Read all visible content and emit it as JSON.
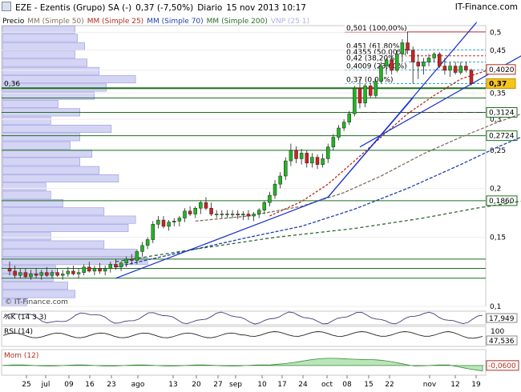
{
  "header": {
    "symbol": "EZE - Ezentis (Grupo) SA (-)",
    "last": "0,37 (-7,50%)",
    "period": "Diario",
    "datetime": "15 nov 2013 10:17",
    "brand": "IT-Finance.com"
  },
  "legend": {
    "price": "Precio",
    "ma50": "MM (Simple 50)",
    "ma25": "MM (Simple 25)",
    "ma70": "MM (Simple 70)",
    "ma200": "MM (Simple 200)",
    "vnp": "VNP (25 1)"
  },
  "watermark": "© IT-Finance.com",
  "colors": {
    "up": "#22b522",
    "down": "#d02020",
    "ma25": "#b03020",
    "ma50": "#807060",
    "ma70": "#2040b0",
    "ma200": "#2a6a2a",
    "trend": "#1a30d0",
    "support": "#1e6e1e",
    "vnp": "#9898e0",
    "fib": "#3aa0c8"
  },
  "chart_data": [
    {
      "type": "candlestick",
      "name": "main",
      "yscale": "log",
      "ylim": [
        0.1,
        0.52
      ],
      "y_ticks": [
        "0,5",
        "0,45",
        "0,4",
        "0,35",
        "0,3",
        "0,25",
        "0,2",
        "0,15",
        "0,1"
      ],
      "y_tick_values": [
        0.5,
        0.45,
        0.4,
        0.35,
        0.3,
        0.25,
        0.2,
        0.15,
        0.1
      ],
      "x_ticks": [
        "25",
        "jul",
        "09",
        "16",
        "23",
        "ago",
        "13",
        "20",
        "27",
        "sep",
        "10",
        "17",
        "24",
        "oct",
        "08",
        "15",
        "22",
        "nov",
        "12",
        "19"
      ],
      "candles": [
        {
          "o": 0.125,
          "h": 0.13,
          "l": 0.12,
          "c": 0.123
        },
        {
          "o": 0.123,
          "h": 0.127,
          "l": 0.118,
          "c": 0.12
        },
        {
          "o": 0.12,
          "h": 0.125,
          "l": 0.118,
          "c": 0.122
        },
        {
          "o": 0.122,
          "h": 0.125,
          "l": 0.118,
          "c": 0.119
        },
        {
          "o": 0.119,
          "h": 0.124,
          "l": 0.117,
          "c": 0.121
        },
        {
          "o": 0.121,
          "h": 0.125,
          "l": 0.118,
          "c": 0.12
        },
        {
          "o": 0.12,
          "h": 0.124,
          "l": 0.117,
          "c": 0.122
        },
        {
          "o": 0.122,
          "h": 0.126,
          "l": 0.119,
          "c": 0.12
        },
        {
          "o": 0.12,
          "h": 0.124,
          "l": 0.118,
          "c": 0.122
        },
        {
          "o": 0.122,
          "h": 0.125,
          "l": 0.119,
          "c": 0.12
        },
        {
          "o": 0.12,
          "h": 0.124,
          "l": 0.117,
          "c": 0.121
        },
        {
          "o": 0.121,
          "h": 0.126,
          "l": 0.119,
          "c": 0.123
        },
        {
          "o": 0.123,
          "h": 0.127,
          "l": 0.12,
          "c": 0.121
        },
        {
          "o": 0.121,
          "h": 0.125,
          "l": 0.118,
          "c": 0.122
        },
        {
          "o": 0.122,
          "h": 0.128,
          "l": 0.12,
          "c": 0.126
        },
        {
          "o": 0.126,
          "h": 0.13,
          "l": 0.122,
          "c": 0.123
        },
        {
          "o": 0.123,
          "h": 0.127,
          "l": 0.12,
          "c": 0.125
        },
        {
          "o": 0.125,
          "h": 0.129,
          "l": 0.121,
          "c": 0.123
        },
        {
          "o": 0.123,
          "h": 0.127,
          "l": 0.12,
          "c": 0.125
        },
        {
          "o": 0.125,
          "h": 0.13,
          "l": 0.122,
          "c": 0.128
        },
        {
          "o": 0.128,
          "h": 0.132,
          "l": 0.124,
          "c": 0.126
        },
        {
          "o": 0.126,
          "h": 0.13,
          "l": 0.123,
          "c": 0.129
        },
        {
          "o": 0.129,
          "h": 0.134,
          "l": 0.126,
          "c": 0.132
        },
        {
          "o": 0.132,
          "h": 0.136,
          "l": 0.128,
          "c": 0.131
        },
        {
          "o": 0.131,
          "h": 0.14,
          "l": 0.128,
          "c": 0.138
        },
        {
          "o": 0.138,
          "h": 0.146,
          "l": 0.134,
          "c": 0.143
        },
        {
          "o": 0.143,
          "h": 0.15,
          "l": 0.14,
          "c": 0.148
        },
        {
          "o": 0.148,
          "h": 0.165,
          "l": 0.145,
          "c": 0.162
        },
        {
          "o": 0.162,
          "h": 0.17,
          "l": 0.158,
          "c": 0.166
        },
        {
          "o": 0.166,
          "h": 0.17,
          "l": 0.158,
          "c": 0.16
        },
        {
          "o": 0.16,
          "h": 0.166,
          "l": 0.156,
          "c": 0.164
        },
        {
          "o": 0.164,
          "h": 0.168,
          "l": 0.16,
          "c": 0.165
        },
        {
          "o": 0.165,
          "h": 0.17,
          "l": 0.16,
          "c": 0.168
        },
        {
          "o": 0.168,
          "h": 0.178,
          "l": 0.164,
          "c": 0.175
        },
        {
          "o": 0.175,
          "h": 0.18,
          "l": 0.17,
          "c": 0.172
        },
        {
          "o": 0.172,
          "h": 0.18,
          "l": 0.168,
          "c": 0.178
        },
        {
          "o": 0.178,
          "h": 0.186,
          "l": 0.172,
          "c": 0.184
        },
        {
          "o": 0.184,
          "h": 0.19,
          "l": 0.176,
          "c": 0.178
        },
        {
          "o": 0.178,
          "h": 0.184,
          "l": 0.17,
          "c": 0.172
        },
        {
          "o": 0.172,
          "h": 0.176,
          "l": 0.168,
          "c": 0.172
        },
        {
          "o": 0.172,
          "h": 0.176,
          "l": 0.168,
          "c": 0.172
        },
        {
          "o": 0.172,
          "h": 0.176,
          "l": 0.168,
          "c": 0.172
        },
        {
          "o": 0.172,
          "h": 0.176,
          "l": 0.168,
          "c": 0.172
        },
        {
          "o": 0.172,
          "h": 0.176,
          "l": 0.167,
          "c": 0.171
        },
        {
          "o": 0.171,
          "h": 0.175,
          "l": 0.166,
          "c": 0.172
        },
        {
          "o": 0.172,
          "h": 0.176,
          "l": 0.166,
          "c": 0.17
        },
        {
          "o": 0.17,
          "h": 0.174,
          "l": 0.165,
          "c": 0.172
        },
        {
          "o": 0.172,
          "h": 0.178,
          "l": 0.168,
          "c": 0.176
        },
        {
          "o": 0.176,
          "h": 0.186,
          "l": 0.172,
          "c": 0.184
        },
        {
          "o": 0.184,
          "h": 0.196,
          "l": 0.18,
          "c": 0.192
        },
        {
          "o": 0.192,
          "h": 0.21,
          "l": 0.188,
          "c": 0.205
        },
        {
          "o": 0.205,
          "h": 0.22,
          "l": 0.2,
          "c": 0.215
        },
        {
          "o": 0.215,
          "h": 0.24,
          "l": 0.21,
          "c": 0.235
        },
        {
          "o": 0.235,
          "h": 0.26,
          "l": 0.228,
          "c": 0.25
        },
        {
          "o": 0.25,
          "h": 0.256,
          "l": 0.232,
          "c": 0.238
        },
        {
          "o": 0.238,
          "h": 0.252,
          "l": 0.23,
          "c": 0.246
        },
        {
          "o": 0.246,
          "h": 0.25,
          "l": 0.226,
          "c": 0.232
        },
        {
          "o": 0.232,
          "h": 0.246,
          "l": 0.226,
          "c": 0.24
        },
        {
          "o": 0.24,
          "h": 0.244,
          "l": 0.224,
          "c": 0.23
        },
        {
          "o": 0.23,
          "h": 0.245,
          "l": 0.226,
          "c": 0.238
        },
        {
          "o": 0.238,
          "h": 0.26,
          "l": 0.232,
          "c": 0.255
        },
        {
          "o": 0.255,
          "h": 0.275,
          "l": 0.25,
          "c": 0.27
        },
        {
          "o": 0.27,
          "h": 0.29,
          "l": 0.265,
          "c": 0.285
        },
        {
          "o": 0.285,
          "h": 0.3,
          "l": 0.28,
          "c": 0.295
        },
        {
          "o": 0.295,
          "h": 0.315,
          "l": 0.29,
          "c": 0.31
        },
        {
          "o": 0.31,
          "h": 0.365,
          "l": 0.305,
          "c": 0.36
        },
        {
          "o": 0.36,
          "h": 0.38,
          "l": 0.32,
          "c": 0.33
        },
        {
          "o": 0.33,
          "h": 0.37,
          "l": 0.322,
          "c": 0.365
        },
        {
          "o": 0.365,
          "h": 0.372,
          "l": 0.34,
          "c": 0.345
        },
        {
          "o": 0.345,
          "h": 0.38,
          "l": 0.34,
          "c": 0.375
        },
        {
          "o": 0.375,
          "h": 0.42,
          "l": 0.37,
          "c": 0.41
        },
        {
          "o": 0.41,
          "h": 0.43,
          "l": 0.39,
          "c": 0.425
        },
        {
          "o": 0.425,
          "h": 0.44,
          "l": 0.39,
          "c": 0.4
        },
        {
          "o": 0.4,
          "h": 0.45,
          "l": 0.395,
          "c": 0.44
        },
        {
          "o": 0.44,
          "h": 0.48,
          "l": 0.42,
          "c": 0.47
        },
        {
          "o": 0.47,
          "h": 0.501,
          "l": 0.44,
          "c": 0.45
        },
        {
          "o": 0.45,
          "h": 0.46,
          "l": 0.37,
          "c": 0.42
        },
        {
          "o": 0.42,
          "h": 0.44,
          "l": 0.38,
          "c": 0.41
        },
        {
          "o": 0.41,
          "h": 0.43,
          "l": 0.39,
          "c": 0.42
        },
        {
          "o": 0.42,
          "h": 0.44,
          "l": 0.41,
          "c": 0.43
        },
        {
          "o": 0.43,
          "h": 0.445,
          "l": 0.42,
          "c": 0.44
        },
        {
          "o": 0.44,
          "h": 0.445,
          "l": 0.405,
          "c": 0.41
        },
        {
          "o": 0.41,
          "h": 0.43,
          "l": 0.39,
          "c": 0.4
        },
        {
          "o": 0.4,
          "h": 0.42,
          "l": 0.385,
          "c": 0.41
        },
        {
          "o": 0.41,
          "h": 0.42,
          "l": 0.39,
          "c": 0.395
        },
        {
          "o": 0.395,
          "h": 0.42,
          "l": 0.39,
          "c": 0.41
        },
        {
          "o": 0.41,
          "h": 0.42,
          "l": 0.395,
          "c": 0.4
        },
        {
          "o": 0.4,
          "h": 0.404,
          "l": 0.366,
          "c": 0.37
        }
      ],
      "horizontal_levels": [
        {
          "label": "0,36",
          "value": 0.36,
          "side": "left"
        },
        {
          "label": "",
          "value": 0.34
        },
        {
          "label": "0,3124",
          "value": 0.3124,
          "side": "right"
        },
        {
          "label": "0,2724",
          "value": 0.2724,
          "side": "right"
        },
        {
          "label": "",
          "value": 0.25
        },
        {
          "label": "0,1860",
          "value": 0.186,
          "side": "right"
        },
        {
          "label": "",
          "value": 0.132
        },
        {
          "label": "",
          "value": 0.125
        },
        {
          "label": "",
          "value": 0.118
        }
      ],
      "fibonacci": [
        {
          "label": "0,501 (100,00%)",
          "value": 0.501
        },
        {
          "label": "0,451 (61,80%)",
          "value": 0.451
        },
        {
          "label": "0,4355 (50,00%)",
          "value": 0.4355
        },
        {
          "label": "0,42 (38,20%)",
          "value": 0.42
        },
        {
          "label": "0,4009 (23,60%)",
          "value": 0.4009
        },
        {
          "label": "0,37 (0,00%)",
          "value": 0.37
        }
      ],
      "price_labels": [
        {
          "label": "0,4020",
          "value": 0.402,
          "kind": "ma25"
        },
        {
          "label": "0,37",
          "value": 0.37,
          "kind": "last"
        }
      ],
      "moving_averages": {
        "ma25": [
          [
            49,
            0.17
          ],
          [
            55,
            0.185
          ],
          [
            60,
            0.205
          ],
          [
            65,
            0.235
          ],
          [
            70,
            0.27
          ],
          [
            75,
            0.31
          ],
          [
            80,
            0.345
          ],
          [
            85,
            0.38
          ],
          [
            90,
            0.4
          ],
          [
            95,
            0.402
          ]
        ],
        "ma50": [
          [
            35,
            0.165
          ],
          [
            45,
            0.17
          ],
          [
            55,
            0.18
          ],
          [
            63,
            0.195
          ],
          [
            70,
            0.215
          ],
          [
            78,
            0.245
          ],
          [
            85,
            0.27
          ],
          [
            92,
            0.295
          ],
          [
            97,
            0.312
          ]
        ],
        "ma70": [
          [
            20,
            0.126
          ],
          [
            35,
            0.14
          ],
          [
            45,
            0.15
          ],
          [
            55,
            0.16
          ],
          [
            65,
            0.177
          ],
          [
            75,
            0.2
          ],
          [
            85,
            0.23
          ],
          [
            92,
            0.255
          ],
          [
            97,
            0.2724
          ]
        ],
        "ma200": [
          [
            20,
            0.13
          ],
          [
            35,
            0.14
          ],
          [
            50,
            0.15
          ],
          [
            65,
            0.158
          ],
          [
            78,
            0.168
          ],
          [
            88,
            0.178
          ],
          [
            97,
            0.186
          ]
        ]
      },
      "vnp_bars": [
        0.3,
        0.31,
        0.34,
        0.3,
        0.35,
        0.4,
        0.55,
        0.43,
        0.38,
        0.23,
        0.32,
        0.2,
        0.45,
        0.32,
        0.28,
        0.37,
        0.32,
        0.4,
        0.48,
        0.18,
        0.2,
        0.25,
        0.42,
        0.55,
        0.52,
        0.2,
        0.42,
        0.55,
        0.6,
        0.22,
        0.21,
        0.27,
        0.3,
        0.1
      ]
    },
    {
      "type": "line",
      "name": "%K",
      "label": "%K (14 3 3)",
      "value_label": "17,949",
      "value": 17.949
    },
    {
      "type": "line",
      "name": "RSI",
      "label": "RSI (14)",
      "value_label": "47,536",
      "value": 47.536,
      "y_ticks": [
        "100",
        "0"
      ]
    },
    {
      "type": "area",
      "name": "Mom",
      "label": "Mom (12)",
      "value_label": "-0,0600",
      "value": -0.06
    }
  ]
}
